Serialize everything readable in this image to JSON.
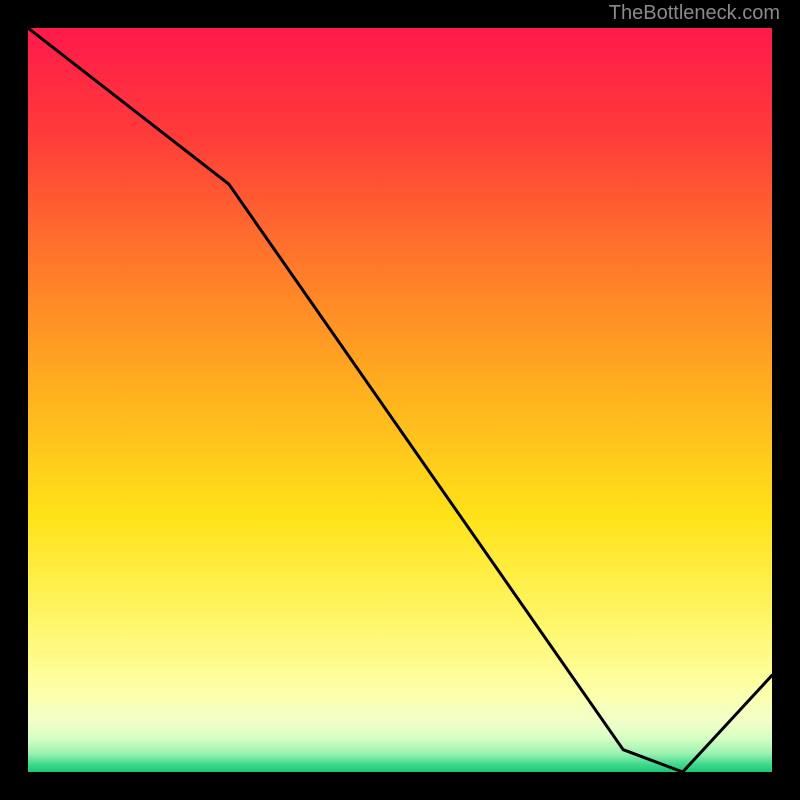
{
  "attribution": "TheBottleneck.com",
  "chart_data": {
    "type": "line",
    "title": "",
    "xlabel": "",
    "ylabel": "",
    "xlim": [
      0,
      100
    ],
    "ylim": [
      0,
      100
    ],
    "x": [
      0,
      27,
      80,
      88,
      100
    ],
    "values": [
      100,
      79,
      3,
      0,
      13
    ],
    "annotation": {
      "text": "",
      "x": 84,
      "y": 1
    },
    "background": "rainbow-gradient"
  },
  "gradient_stops": [
    {
      "p": 0.0,
      "c": "#ff1a4b"
    },
    {
      "p": 0.14,
      "c": "#ff3a3a"
    },
    {
      "p": 0.32,
      "c": "#ff7a2a"
    },
    {
      "p": 0.5,
      "c": "#ffb41e"
    },
    {
      "p": 0.66,
      "c": "#ffe31a"
    },
    {
      "p": 0.8,
      "c": "#fff76a"
    },
    {
      "p": 0.89,
      "c": "#fdffa8"
    },
    {
      "p": 0.93,
      "c": "#f3ffc8"
    },
    {
      "p": 0.955,
      "c": "#d6ffc3"
    },
    {
      "p": 0.975,
      "c": "#9bf2b1"
    },
    {
      "p": 0.99,
      "c": "#3fd88c"
    },
    {
      "p": 1.0,
      "c": "#18c977"
    }
  ]
}
